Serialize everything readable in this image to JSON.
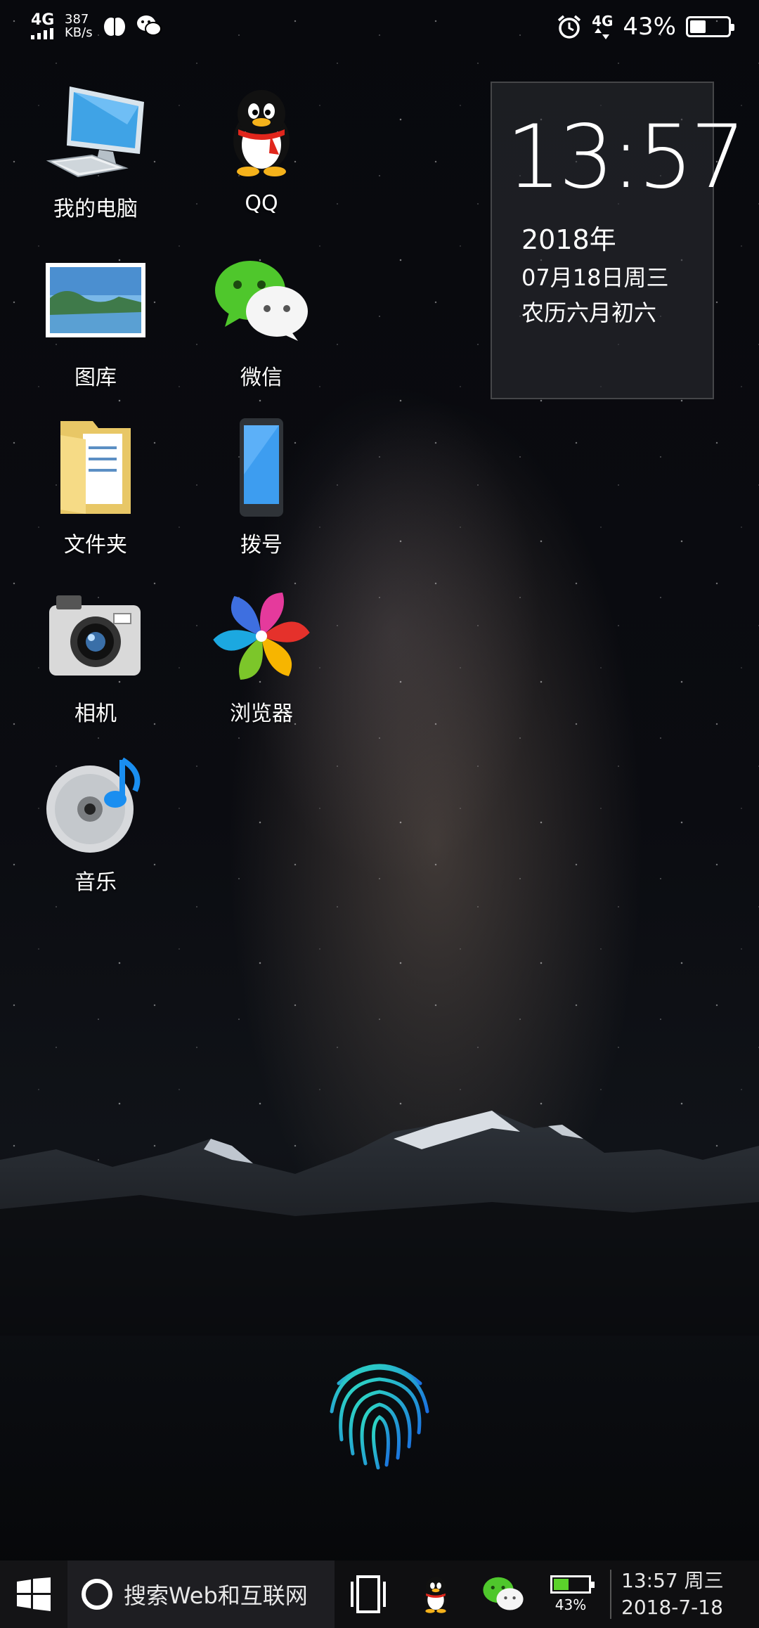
{
  "status_bar": {
    "network_type": "4G",
    "speed_value": "387",
    "speed_unit": "KB/s",
    "right_network": "4G",
    "battery_percent_text": "43%",
    "battery_level": 0.43,
    "icons": [
      "signal-icon",
      "app-notification-icon",
      "wechat-notification-icon",
      "alarm-icon",
      "data-arrows-icon",
      "battery-icon"
    ]
  },
  "apps": [
    {
      "id": "my-computer",
      "label": "我的电脑",
      "icon": "computer-icon"
    },
    {
      "id": "qq",
      "label": "QQ",
      "icon": "qq-penguin-icon"
    },
    {
      "id": "gallery",
      "label": "图库",
      "icon": "landscape-photo-icon"
    },
    {
      "id": "wechat",
      "label": "微信",
      "icon": "wechat-icon"
    },
    {
      "id": "folder",
      "label": "文件夹",
      "icon": "folder-icon"
    },
    {
      "id": "dialer",
      "label": "拨号",
      "icon": "phone-icon"
    },
    {
      "id": "camera",
      "label": "相机",
      "icon": "camera-icon"
    },
    {
      "id": "browser",
      "label": "浏览器",
      "icon": "pinwheel-icon"
    },
    {
      "id": "music",
      "label": "音乐",
      "icon": "cd-music-icon"
    }
  ],
  "clock_widget": {
    "time": "13:57",
    "year": "2018年",
    "date": "07月18日周三",
    "lunar": "农历六月初六"
  },
  "taskbar": {
    "start_icon": "windows-icon",
    "search_text": "搜索Web和互联网",
    "battery_percent": "43%",
    "battery_level": 0.43,
    "time_line": "13:57 周三",
    "date_line": "2018-7-18",
    "colors": {
      "battery_fill": "#5bd22b"
    }
  }
}
